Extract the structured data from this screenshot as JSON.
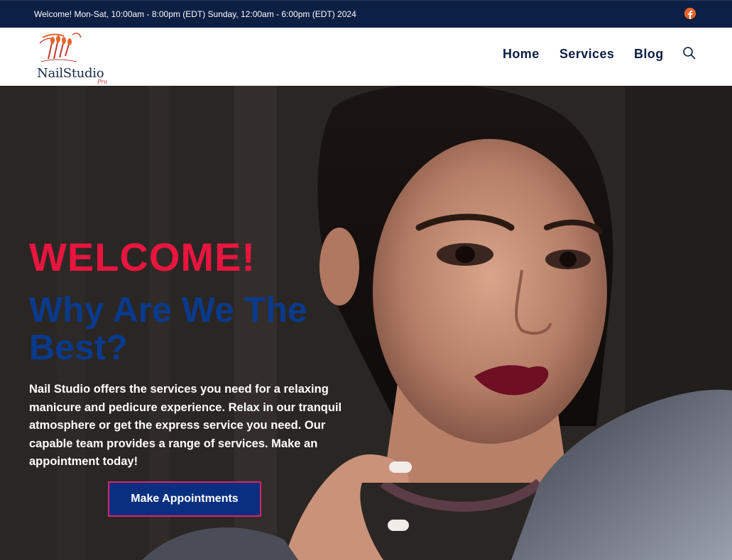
{
  "topbar": {
    "welcome_text": "Welcome! Mon-Sat, 10:00am - 8:00pm (EDT) Sunday, 12:00am - 6:00pm (EDT) 2024",
    "social_icon": "facebook-icon"
  },
  "header": {
    "logo_name": "NailStudio",
    "logo_suffix": "Pro",
    "nav": [
      {
        "label": "Home"
      },
      {
        "label": "Services"
      },
      {
        "label": "Blog"
      }
    ],
    "search_icon": "search-icon"
  },
  "hero": {
    "welcome": "WELCOME!",
    "headline": "Why Are We The Best?",
    "description": "Nail Studio offers the services you need for a relaxing manicure and pedicure experience. Relax in our tranquil atmosphere or get the express service you need. Our capable team provides a range of services. Make an appointment today!",
    "cta_label": "Make Appointments"
  },
  "colors": {
    "topbar_bg": "#0c1f44",
    "accent_red": "#e8153f",
    "headline_blue": "#0a3a8c",
    "cta_bg": "#0a2f80",
    "cta_border": "#d9246a",
    "facebook": "#e8642b"
  }
}
